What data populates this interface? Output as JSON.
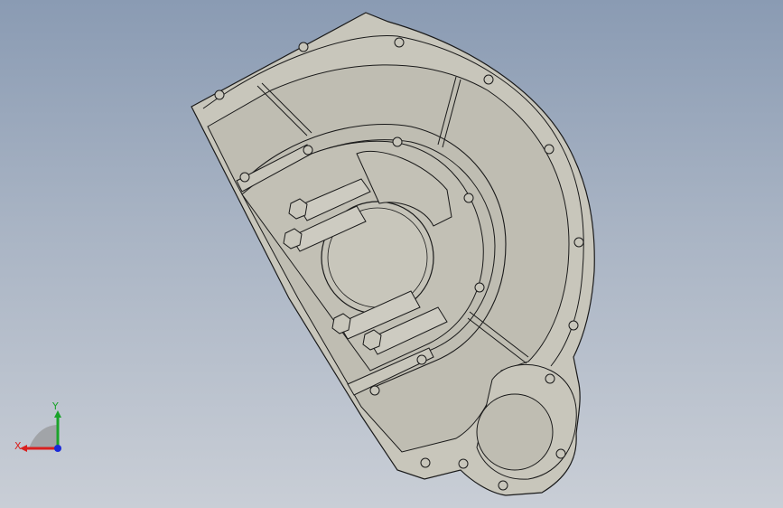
{
  "viewport": {
    "background_top": "#8a9bb3",
    "background_bottom": "#c9ced6"
  },
  "model": {
    "part_color": "#c8c6bb",
    "edge_color": "#1a1a1a"
  },
  "triad": {
    "x_label": "X",
    "y_label": "Y",
    "x_color": "#d9201f",
    "y_color": "#1aa32a",
    "z_color": "#1a2ad9"
  }
}
